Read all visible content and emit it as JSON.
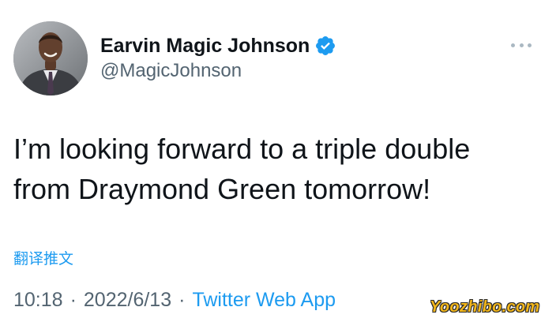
{
  "author": {
    "display_name": "Earvin Magic Johnson",
    "handle": "@MagicJohnson",
    "verified": true,
    "avatar_icon": "profile-photo-man-in-suit"
  },
  "tweet": {
    "text": "I’m looking forward to a triple double\nfrom Draymond Green tomorrow!",
    "translate_label": "翻译推文",
    "time": "10:18",
    "date": "2022/6/13",
    "separator": "·",
    "source": "Twitter Web App"
  },
  "more_icon": "more-horizontal-icon",
  "watermark": "Yoozhibo.com",
  "colors": {
    "text": "#0f1419",
    "secondary": "#536471",
    "accent": "#1d9bf0",
    "watermark": "#f2b61b"
  }
}
